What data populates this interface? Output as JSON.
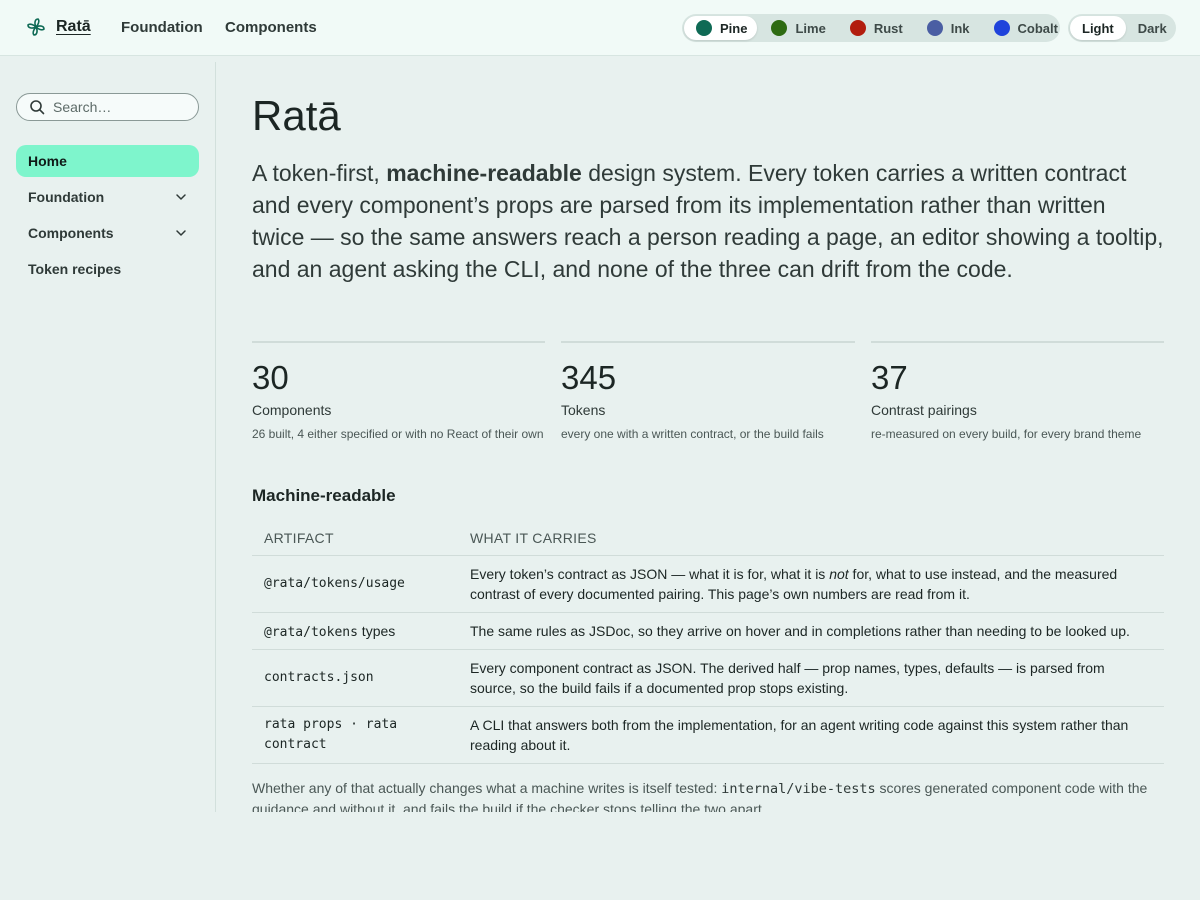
{
  "header": {
    "brand_name": "Ratā",
    "nav": [
      "Foundation",
      "Components"
    ],
    "brand_themes": [
      {
        "label": "Pine",
        "color": "#0f6a55",
        "active": true
      },
      {
        "label": "Lime",
        "color": "#2e6b12",
        "active": false
      },
      {
        "label": "Rust",
        "color": "#b21d0e",
        "active": false
      },
      {
        "label": "Ink",
        "color": "#4a5ea3",
        "active": false
      },
      {
        "label": "Cobalt",
        "color": "#1f43db",
        "active": false
      }
    ],
    "modes": [
      {
        "label": "Light",
        "active": true
      },
      {
        "label": "Dark",
        "active": false
      }
    ]
  },
  "sidebar": {
    "search_placeholder": "Search…",
    "items": [
      {
        "label": "Home",
        "active": true,
        "expandable": false
      },
      {
        "label": "Foundation",
        "active": false,
        "expandable": true
      },
      {
        "label": "Components",
        "active": false,
        "expandable": true
      },
      {
        "label": "Token recipes",
        "active": false,
        "expandable": false
      }
    ]
  },
  "main": {
    "title": "Ratā",
    "lede": {
      "before": "A token-first, ",
      "emphasis": "machine-readable",
      "after": " design system. Every token carries a written contract and every component’s props are parsed from its implementation rather than written twice — so the same answers reach a person reading a page, an editor showing a tooltip, and an agent asking the CLI, and none of the three can drift from the code."
    },
    "stats": [
      {
        "value": "30",
        "label": "Components",
        "note": "26 built, 4 either specified or with no React of their own"
      },
      {
        "value": "345",
        "label": "Tokens",
        "note": "every one with a written contract, or the build fails"
      },
      {
        "value": "37",
        "label": "Contrast pairings",
        "note": "re-measured on every build, for every brand theme"
      }
    ],
    "section_title": "Machine-readable",
    "table": {
      "headers": [
        "ARTIFACT",
        "WHAT IT CARRIES"
      ],
      "rows": [
        {
          "artifact_code": "@rata/tokens/usage",
          "artifact_suffix": "",
          "desc_before": "Every token’s contract as JSON — what it is for, what it is ",
          "desc_em": "not",
          "desc_after": " for, what to use instead, and the measured contrast of every documented pairing. This page’s own numbers are read from it."
        },
        {
          "artifact_code": "@rata/tokens",
          "artifact_suffix": " types",
          "desc_before": "The same rules as JSDoc, so they arrive on hover and in completions rather than needing to be looked up.",
          "desc_em": "",
          "desc_after": ""
        },
        {
          "artifact_code": "contracts.json",
          "artifact_suffix": "",
          "desc_before": "Every component contract as JSON. The derived half — prop names, types, defaults — is parsed from source, so the build fails if a documented prop stops existing.",
          "desc_em": "",
          "desc_after": ""
        },
        {
          "artifact_code": "rata props · rata contract",
          "artifact_suffix": "",
          "desc_before": "A CLI that answers both from the implementation, for an agent writing code against this system rather than reading about it.",
          "desc_em": "",
          "desc_after": ""
        }
      ]
    },
    "footnote": {
      "before": "Whether any of that actually changes what a machine writes is itself tested: ",
      "code": "internal/vibe-tests",
      "after": " scores generated component code with the guidance and without it, and fails the build if the checker stops telling the two apart."
    }
  }
}
